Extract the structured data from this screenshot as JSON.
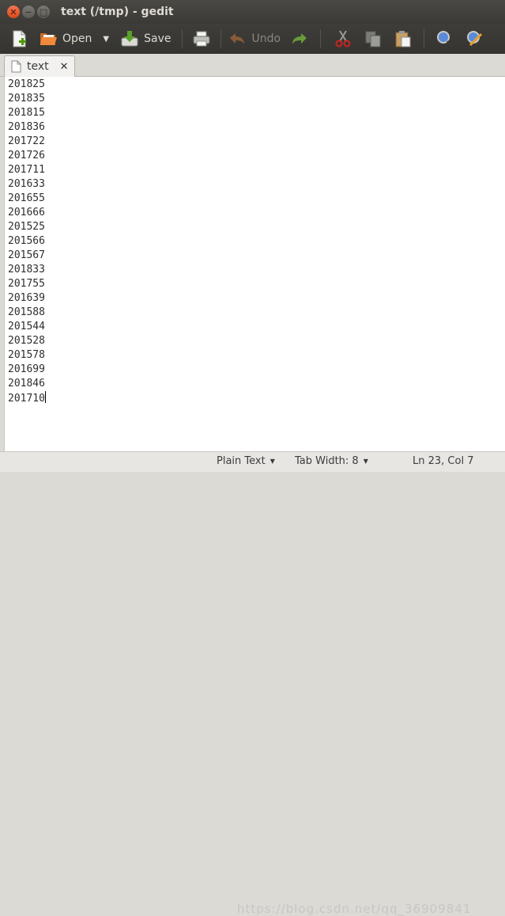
{
  "window": {
    "title": "text (/tmp) - gedit"
  },
  "toolbar": {
    "new_icon": "new-document-icon",
    "open_label": "Open",
    "save_label": "Save",
    "print_icon": "print-icon",
    "undo_label": "Undo",
    "redo_icon": "redo-icon",
    "cut_icon": "cut-icon",
    "copy_icon": "copy-icon",
    "paste_icon": "paste-icon",
    "search_icon": "search-icon",
    "replace_icon": "search-replace-icon"
  },
  "tab": {
    "label": "text",
    "close_glyph": "✕"
  },
  "editor": {
    "lines": [
      "201825",
      "201835",
      "201815",
      "201836",
      "201722",
      "201726",
      "201711",
      "201633",
      "201655",
      "201666",
      "201525",
      "201566",
      "201567",
      "201833",
      "201755",
      "201639",
      "201588",
      "201544",
      "201528",
      "201578",
      "201699",
      "201846",
      "201710"
    ]
  },
  "statusbar": {
    "language": "Plain Text",
    "tab_width": "Tab Width: 8",
    "position": "Ln 23, Col 7",
    "watermark": "https://blog.csdn.net/qq_36909841"
  }
}
